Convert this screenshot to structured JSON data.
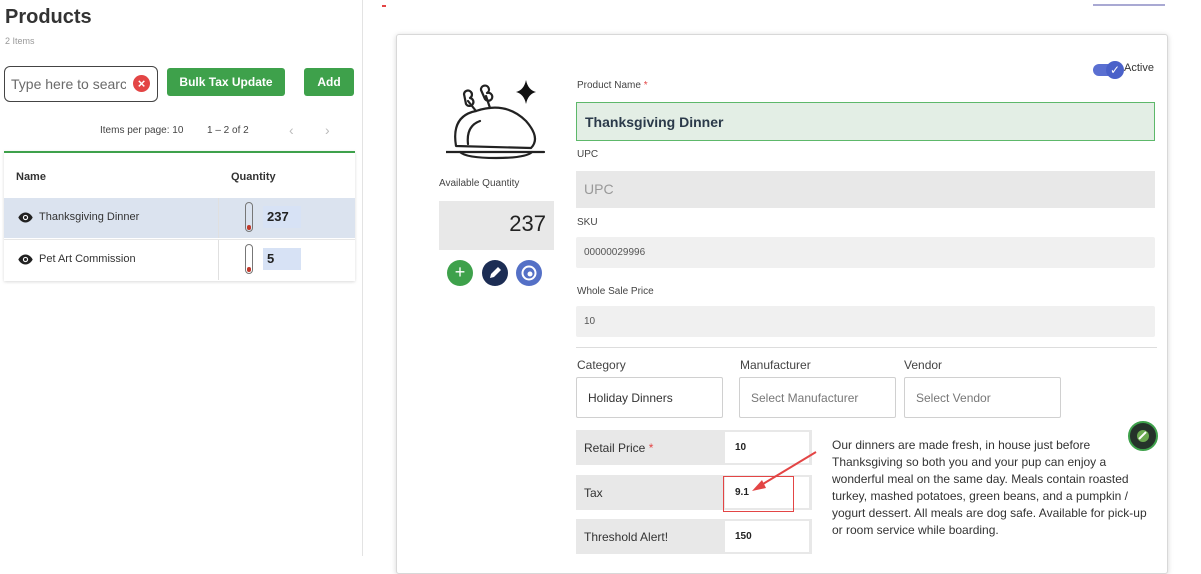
{
  "left_panel": {
    "title": "Products",
    "subtitle": "2 Items",
    "search": {
      "placeholder": "Type here to search"
    },
    "bulk_tax_label": "Bulk Tax Update",
    "add_label": "Add",
    "pager": {
      "items_per_page_label": "Items per page: 10",
      "range": "1 – 2 of 2"
    },
    "table": {
      "headers": [
        "Name",
        "Quantity"
      ],
      "rows": [
        {
          "name": "Thanksgiving Dinner",
          "quantity": "237",
          "selected": true
        },
        {
          "name": "Pet Art Commission",
          "quantity": "5",
          "selected": false
        }
      ]
    }
  },
  "product_form": {
    "available_quantity_label": "Available Quantity",
    "available_quantity": "237",
    "active_label": "Active",
    "active": true,
    "product_name_label": "Product Name",
    "required_star": "*",
    "product_name_value": "Thanksgiving Dinner",
    "upc_label": "UPC",
    "upc_placeholder": "UPC",
    "sku_label": "SKU",
    "sku_value": "00000029996",
    "wholesale_label": "Whole Sale Price",
    "wholesale_value": "10",
    "category_label": "Category",
    "category_value": "Holiday Dinners",
    "manufacturer_label": "Manufacturer",
    "manufacturer_placeholder": "Select Manufacturer",
    "vendor_label": "Vendor",
    "vendor_placeholder": "Select Vendor",
    "retail_price_label": "Retail Price",
    "retail_price_value": "10",
    "tax_label": "Tax",
    "tax_value": "9.1",
    "threshold_label": "Threshold Alert!",
    "threshold_value": "150",
    "description": "Our dinners are made fresh, in house just before Thanksgiving so both you and your pup can enjoy a wonderful meal on the same day. Meals contain roasted turkey, mashed potatoes, green beans, and a pumpkin / yogurt dessert. All meals are dog safe. Available for pick-up or room service while boarding."
  },
  "colors": {
    "accent_green": "#3ea14b",
    "danger_red": "#e34545",
    "navy": "#1c2d54",
    "blue": "#5470c6"
  }
}
